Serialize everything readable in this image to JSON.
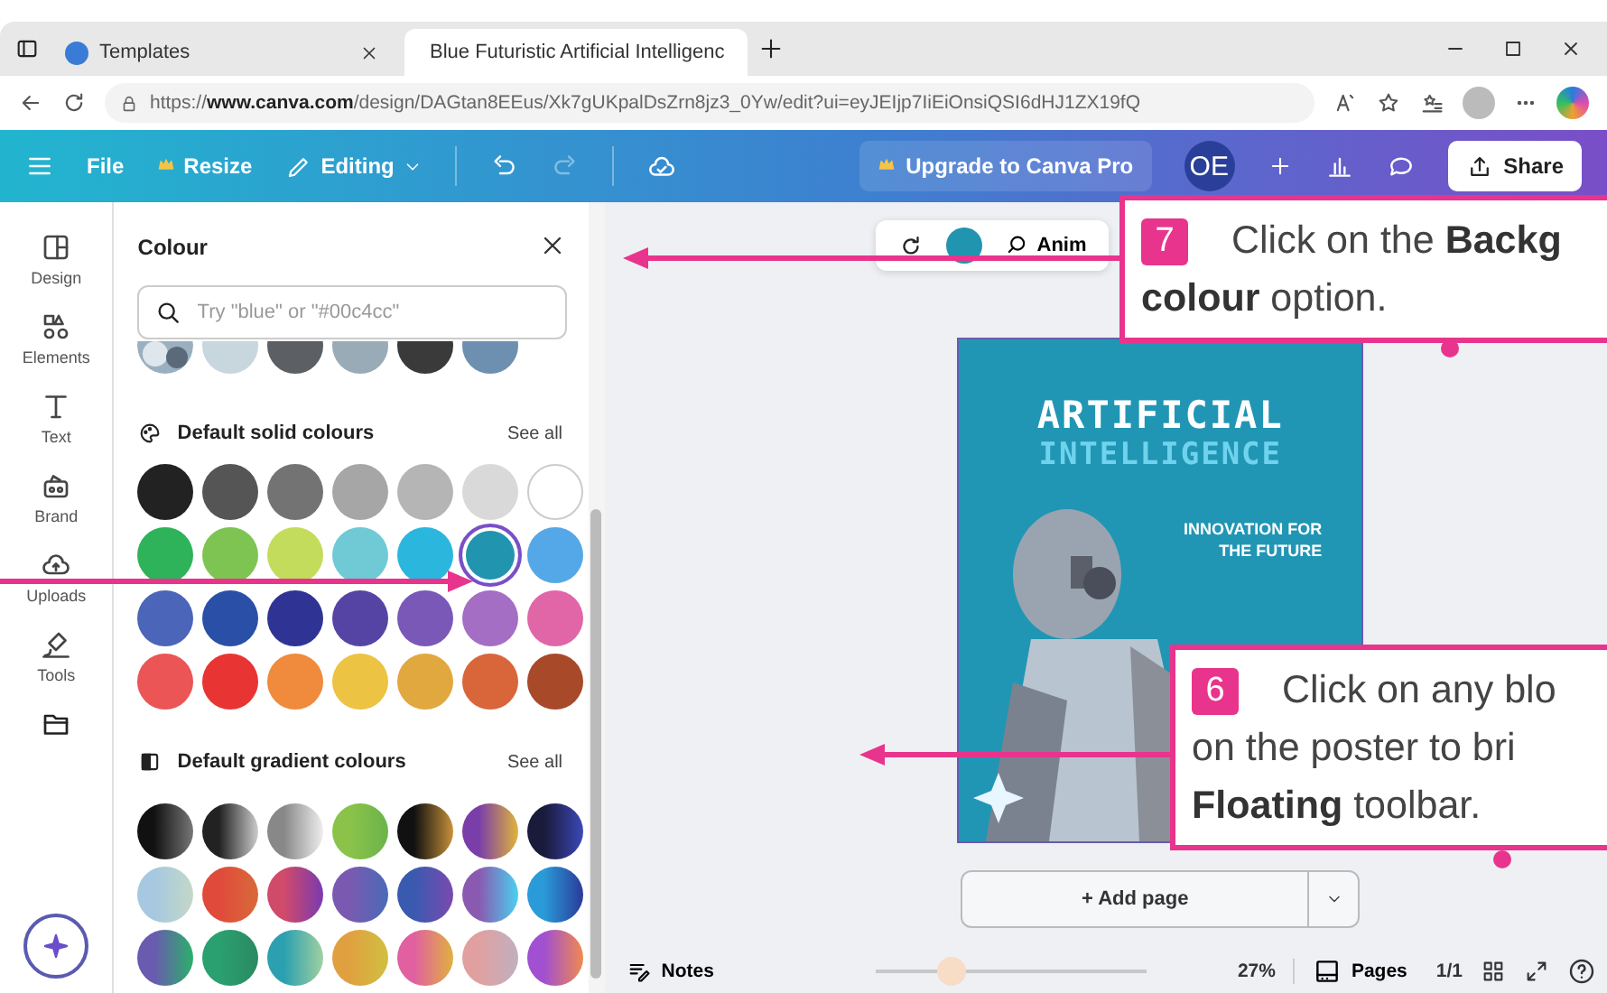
{
  "browser": {
    "tabs": [
      {
        "title": "Templates",
        "selected": false
      },
      {
        "title": "Blue Futuristic Artificial Intelligenc",
        "selected": true
      }
    ],
    "url": "https://**www.canva.com**/design/DAGtan8EEus/Xk7gUKpalDsZrn8jz3_0Yw/edit?ui=eyJEIjp7IiEiOnsiQSI6dHJ1ZX19fQ"
  },
  "toolbar": {
    "file": "File",
    "resize": "Resize",
    "editing": "Editing",
    "upgrade": "Upgrade to Canva Pro",
    "avatar": "OE",
    "share": "Share"
  },
  "rail": [
    {
      "label": "Design"
    },
    {
      "label": "Elements"
    },
    {
      "label": "Text"
    },
    {
      "label": "Brand"
    },
    {
      "label": "Uploads"
    },
    {
      "label": "Tools"
    }
  ],
  "panel": {
    "title": "Colour",
    "search_placeholder": "Try \"blue\" or \"#00c4cc\"",
    "recent": [
      {
        "kind": "picture"
      },
      {
        "kind": "solid",
        "color": "#c8d6dd"
      },
      {
        "kind": "solid",
        "color": "#5c5f63"
      },
      {
        "kind": "solid",
        "color": "#9aabb8"
      },
      {
        "kind": "solid",
        "color": "#3a3a3a"
      },
      {
        "kind": "solid",
        "color": "#6d8fb0"
      }
    ],
    "solid_title": "Default solid colours",
    "solid_see_all": "See all",
    "solid": [
      {
        "color": "#222222",
        "selected": false
      },
      {
        "color": "#555555",
        "selected": false
      },
      {
        "color": "#737373",
        "selected": false
      },
      {
        "color": "#a6a6a6",
        "selected": false
      },
      {
        "color": "#b5b5b5",
        "selected": false
      },
      {
        "color": "#d9d9d9",
        "selected": false
      },
      {
        "color": "#ffffff",
        "selected": false
      },
      {
        "color": "#2eb35a",
        "selected": false
      },
      {
        "color": "#7ec452",
        "selected": false
      },
      {
        "color": "#c3dc5c",
        "selected": false
      },
      {
        "color": "#6fcad6",
        "selected": false
      },
      {
        "color": "#2bb7dd",
        "selected": false
      },
      {
        "color": "#2194b0",
        "selected": true
      },
      {
        "color": "#54a8e8",
        "selected": false
      },
      {
        "color": "#4b65b8",
        "selected": false
      },
      {
        "color": "#2a4fa6",
        "selected": false
      },
      {
        "color": "#2f3494",
        "selected": false
      },
      {
        "color": "#5644a4",
        "selected": false
      },
      {
        "color": "#7a58b8",
        "selected": false
      },
      {
        "color": "#a46ec4",
        "selected": false
      },
      {
        "color": "#e066a8",
        "selected": false
      },
      {
        "color": "#ec5555",
        "selected": false
      },
      {
        "color": "#e93434",
        "selected": false
      },
      {
        "color": "#f08a3c",
        "selected": false
      },
      {
        "color": "#ecc342",
        "selected": false
      },
      {
        "color": "#e2a840",
        "selected": false
      },
      {
        "color": "#d8663a",
        "selected": false
      },
      {
        "color": "#a8492a",
        "selected": false
      }
    ],
    "gradient_title": "Default gradient colours",
    "gradient_see_all": "See all",
    "gradient": [
      {
        "color": "#111111"
      },
      {
        "color": "#222222"
      },
      {
        "color": "#888888"
      },
      {
        "color": "#8bc34a"
      },
      {
        "color": "#111111"
      },
      {
        "color": "#7a3ea8"
      },
      {
        "color": "#1a1a3a"
      },
      {
        "color": "#a6c8e0"
      },
      {
        "color": "#e04a3a"
      },
      {
        "color": "#d04a6a"
      },
      {
        "color": "#7a5ab0"
      },
      {
        "color": "#3a5ab0"
      },
      {
        "color": "#8a5ab0"
      },
      {
        "color": "#2a9ad8"
      },
      {
        "color": "#6a5ab0"
      },
      {
        "color": "#2aa070"
      },
      {
        "color": "#2aa0b0"
      },
      {
        "color": "#e0a040"
      },
      {
        "color": "#e060a0"
      },
      {
        "color": "#e0a0a0"
      },
      {
        "color": "#a050d0"
      }
    ]
  },
  "floating_toolbar": {
    "color": "#2194b0",
    "label": "Anim"
  },
  "poster": {
    "title": "ARTIFICIAL",
    "subtitle": "INTELLIGENCE",
    "tagline": [
      "INNOVATION FOR",
      "THE FUTURE"
    ]
  },
  "add_page": "+ Add page",
  "status_bar": {
    "notes": "Notes",
    "level": 0.28,
    "zoom": "27%",
    "pages": "Pages",
    "page_count": "1/1"
  },
  "callouts": [
    {
      "number": "7",
      "lines": [
        "Click on the **Backg**",
        "**colour** option."
      ]
    },
    {
      "number": "6",
      "lines": [
        "Click on any blo",
        "on the poster to bri",
        "**Floating** toolbar."
      ]
    }
  ]
}
